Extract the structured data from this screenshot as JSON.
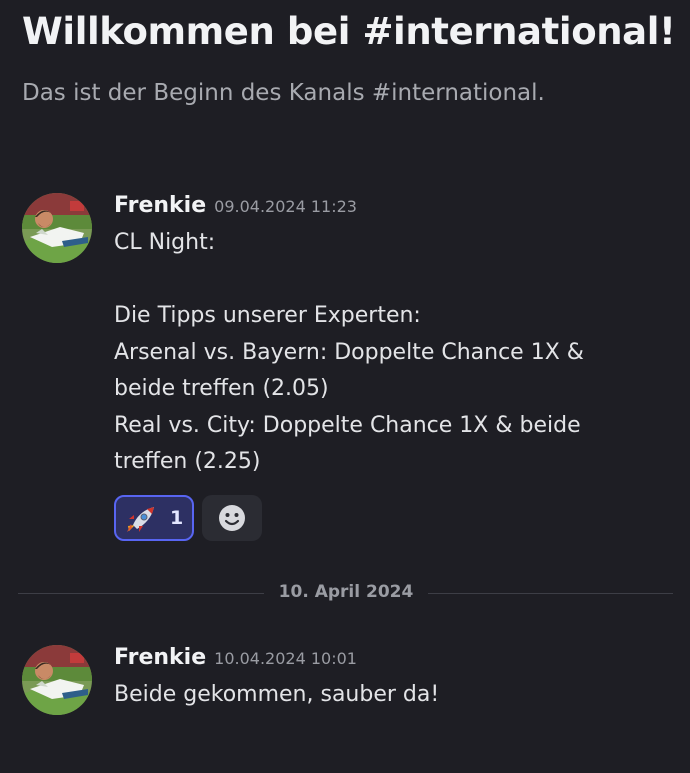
{
  "channel": {
    "welcome_title": "Willkommen bei #international!",
    "welcome_subtitle": "Das ist der Beginn des Kanals #international."
  },
  "messages": [
    {
      "author": "Frenkie",
      "timestamp": "09.04.2024 11:23",
      "avatar_icon": "soccer-player-avatar",
      "lines": [
        "CL Night:",
        "",
        "Die Tipps unserer Experten:",
        "Arsenal vs. Bayern: Doppelte Chance 1X &",
        "beide treffen (2.05)",
        "Real vs. City: Doppelte Chance 1X & beide",
        "treffen (2.25)"
      ],
      "reactions": [
        {
          "emoji": "rocket-icon",
          "count": "1",
          "selected": true
        }
      ],
      "add_reaction_icon": "smiley-icon"
    },
    {
      "author": "Frenkie",
      "timestamp": "10.04.2024 10:01",
      "avatar_icon": "soccer-player-avatar",
      "lines": [
        "Beide gekommen, sauber da!"
      ]
    }
  ],
  "date_divider": {
    "label": "10. April 2024"
  },
  "colors": {
    "background": "#1e1e24",
    "accent": "#5865f2",
    "muted_text": "#9a9ca3"
  }
}
